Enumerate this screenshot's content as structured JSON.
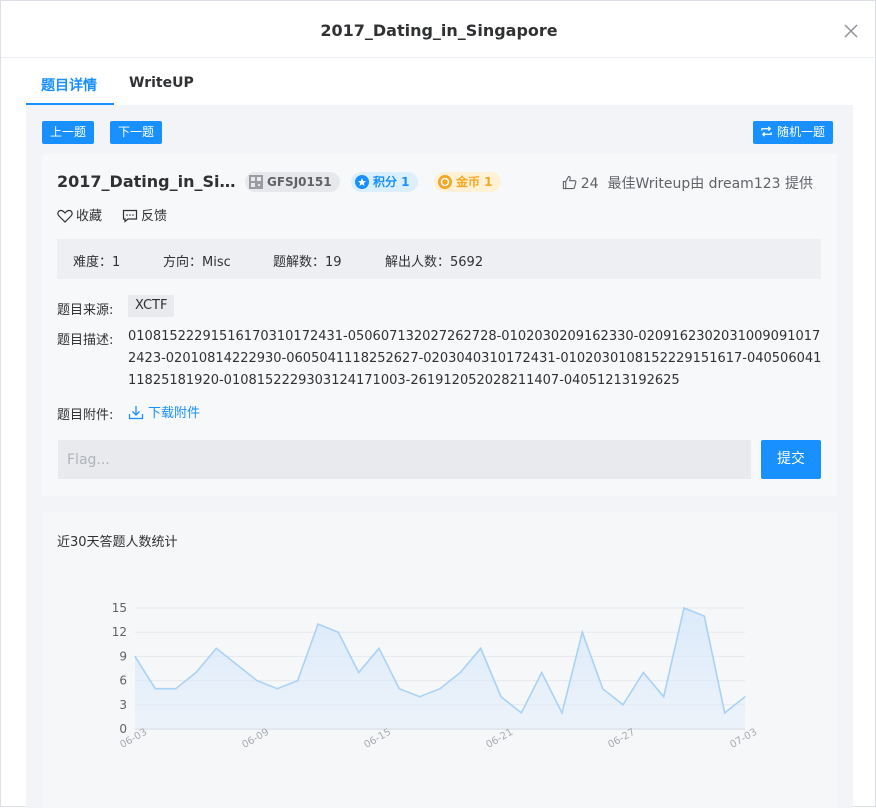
{
  "modal": {
    "title": "2017_Dating_in_Singapore"
  },
  "tabs": [
    {
      "label": "题目详情",
      "active": true
    },
    {
      "label": "WriteUP",
      "active": false
    }
  ],
  "toolbar": {
    "prev_label": "上一题",
    "next_label": "下一题",
    "random_label": "随机一题"
  },
  "challenge": {
    "title": "2017_Dating_in_Sing...",
    "id_badge": "GFSJ0151",
    "score_badge": "积分 1",
    "coin_badge": "金币 1",
    "likes": "24",
    "best_writeup": "最佳Writeup由 dream123 提供",
    "favorite_label": "收藏",
    "feedback_label": "反馈",
    "stats": {
      "difficulty": "难度：1",
      "direction": "方向：Misc",
      "writeups": "题解数：19",
      "solvers": "解出人数：5692"
    },
    "source_label": "题目来源:",
    "source_value": "XCTF",
    "desc_label": "题目描述:",
    "description": "01081522291516170310172431-050607132027262728-0102030209162330-02091623020310090910172423-02010814222930-0605041118252627-0203040310172431-0102030108152229151617-04050604111825181920-0108152229303124171003-261912052028211407-04051213192625",
    "attachment_label": "题目附件:",
    "download_label": "下载附件",
    "flag_placeholder": "Flag...",
    "submit_label": "提交"
  },
  "chart_data": {
    "type": "area",
    "title": "近30天答题人数统计",
    "x": [
      "06-03",
      "06-04",
      "06-05",
      "06-06",
      "06-07",
      "06-08",
      "06-09",
      "06-10",
      "06-11",
      "06-12",
      "06-13",
      "06-14",
      "06-15",
      "06-16",
      "06-17",
      "06-18",
      "06-19",
      "06-20",
      "06-21",
      "06-22",
      "06-23",
      "06-24",
      "06-25",
      "06-26",
      "06-27",
      "06-28",
      "06-29",
      "06-30",
      "07-01",
      "07-02",
      "07-03"
    ],
    "values": [
      9,
      5,
      5,
      7,
      10,
      8,
      6,
      5,
      6,
      13,
      12,
      7,
      10,
      5,
      4,
      5,
      7,
      10,
      4,
      2,
      7,
      2,
      12,
      5,
      3,
      7,
      4,
      15,
      14,
      2,
      4
    ],
    "x_tick_labels": [
      "06-03",
      "06-09",
      "06-15",
      "06-21",
      "06-27",
      "07-03"
    ],
    "y_ticks": [
      0,
      3,
      6,
      9,
      12,
      15
    ],
    "ylim": [
      0,
      15
    ],
    "grid": true,
    "line_color": "#a9d2f7",
    "fill_color": "#dbeafa"
  },
  "colors": {
    "accent": "#1890ff",
    "coin": "#f5a623"
  }
}
